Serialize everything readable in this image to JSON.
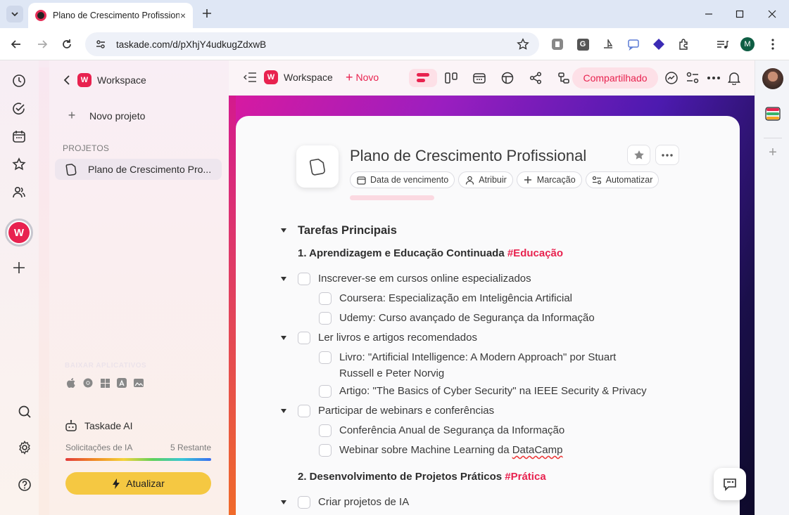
{
  "browser": {
    "tab_title": "Plano de Crescimento Profissional",
    "tab_close": "×",
    "url": "taskade.com/d/pXhjY4udkugZdxwB",
    "extension_letter_g": "G",
    "profile_initial": "M"
  },
  "sidebar": {
    "back_label": "Workspace",
    "workspace_badge": "W",
    "new_project_label": "Novo projeto",
    "section_label": "PROJETOS",
    "projects": [
      {
        "label": "Plano de Crescimento Pro..."
      }
    ],
    "download_label": "BAIXAR APLICATIVOS",
    "ai_label": "Taskade AI",
    "requests_label": "Solicitações de IA",
    "requests_remaining": "5 Restante",
    "upgrade_label": "Atualizar"
  },
  "rail": {
    "workspace_badge": "W"
  },
  "header": {
    "workspace_label": "Workspace",
    "workspace_badge": "W",
    "new_label": "Novo",
    "share_label": "Compartilhado"
  },
  "document": {
    "title": "Plano de Crescimento Profissional",
    "chips": [
      {
        "label": "Data de vencimento",
        "icon": "calendar-icon"
      },
      {
        "label": "Atribuir",
        "icon": "person-icon"
      },
      {
        "label": "Marcação",
        "icon": "plus-icon"
      },
      {
        "label": "Automatizar",
        "icon": "automation-icon"
      }
    ],
    "main_heading": "Tarefas Principais",
    "sections": [
      {
        "title": "1. Aprendizagem e Educação Continuada",
        "tag": "#Educação"
      },
      {
        "title": "2. Desenvolvimento de Projetos Práticos",
        "tag": "#Prática"
      }
    ],
    "tasks": [
      "Inscrever-se em cursos online especializados",
      "Coursera: Especialização em Inteligência Artificial",
      "Udemy: Curso avançado de Segurança da Informação",
      "Ler livros e artigos recomendados",
      "Livro: \"Artificial Intelligence: A Modern Approach\" por Stuart",
      "Russell e Peter Norvig",
      "Artigo: \"The Basics of Cyber Security\" na IEEE Security & Privacy",
      "Participar de webinars e conferências",
      "Conferência Anual de Segurança da Informação",
      "Webinar sobre Machine Learning da ",
      "DataCamp",
      "Criar projetos de IA"
    ]
  },
  "colors": {
    "brand": "#e8224f",
    "upgrade": "#f5c842"
  }
}
